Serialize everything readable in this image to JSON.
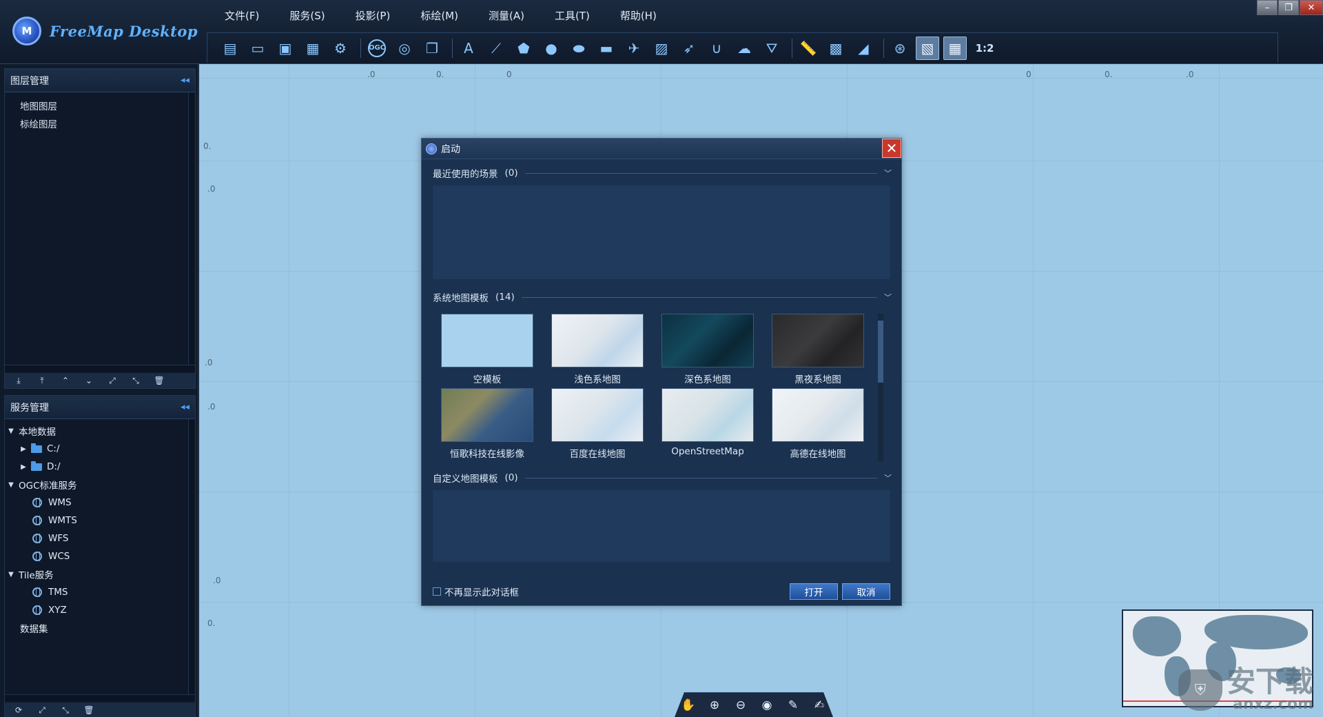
{
  "app": {
    "name": "FreeMap Desktop",
    "logo_letter": "M"
  },
  "menu": [
    "文件(F)",
    "服务(S)",
    "投影(P)",
    "标绘(M)",
    "测量(A)",
    "工具(T)",
    "帮助(H)"
  ],
  "toolbar": {
    "icons": [
      "new-document-icon",
      "open-folder-icon",
      "save-icon",
      "save-as-icon",
      "settings-gear-icon",
      "ogc-icon",
      "globe-icon",
      "layers-icon",
      "text-icon",
      "polyline-icon",
      "polygon-icon",
      "circle-icon",
      "ellipse-icon",
      "rectangle-icon",
      "airplane-icon",
      "image-icon",
      "arrow-icon",
      "magnet-icon",
      "cloud-icon",
      "triangle-group-icon",
      "ruler-icon",
      "area-measure-icon",
      "protractor-icon",
      "compass-icon",
      "overview-icon",
      "grid-icon"
    ],
    "ogc_label": "OGC",
    "scale_label": "1:2"
  },
  "layer_panel": {
    "title": "图层管理",
    "items": [
      "地图图层",
      "标绘图层"
    ]
  },
  "service_panel": {
    "title": "服务管理",
    "tree": {
      "local": {
        "label": "本地数据",
        "children": [
          "C:/",
          "D:/"
        ]
      },
      "ogc": {
        "label": "OGC标准服务",
        "children": [
          "WMS",
          "WMTS",
          "WFS",
          "WCS"
        ]
      },
      "tile": {
        "label": "Tile服务",
        "children": [
          "TMS",
          "XYZ"
        ]
      },
      "dataset": "数据集"
    }
  },
  "map": {
    "coord_labels": [
      ".0",
      "0.",
      "0",
      "0",
      "0.",
      ".0",
      "0.",
      ".0",
      ".0",
      ".0",
      ".0",
      "0."
    ]
  },
  "dialog": {
    "title": "启动",
    "recent": {
      "label": "最近使用的场景",
      "count": "(0)"
    },
    "system": {
      "label": "系统地图模板",
      "count": "(14)"
    },
    "custom": {
      "label": "自定义地图模板",
      "count": "(0)"
    },
    "templates": [
      {
        "name": "空模板",
        "style": "blank"
      },
      {
        "name": "浅色系地图",
        "style": "light"
      },
      {
        "name": "深色系地图",
        "style": "dark"
      },
      {
        "name": "黑夜系地图",
        "style": "night"
      },
      {
        "name": "恒歌科技在线影像",
        "style": "satellite"
      },
      {
        "name": "百度在线地图",
        "style": "baidu"
      },
      {
        "name": "OpenStreetMap",
        "style": "osm"
      },
      {
        "name": "高德在线地图",
        "style": "gaode"
      }
    ],
    "dont_show": "不再显示此对话框",
    "open_button": "打开",
    "cancel_button": "取消"
  },
  "watermark": {
    "cn": "安下载",
    "en": "anxz.com"
  },
  "colors": {
    "map_bg": "#9ec9e6",
    "panel_bg": "#0e1828",
    "dialog_bg": "#1a3150",
    "accent": "#4f9dff",
    "close_red": "#c9382c"
  }
}
